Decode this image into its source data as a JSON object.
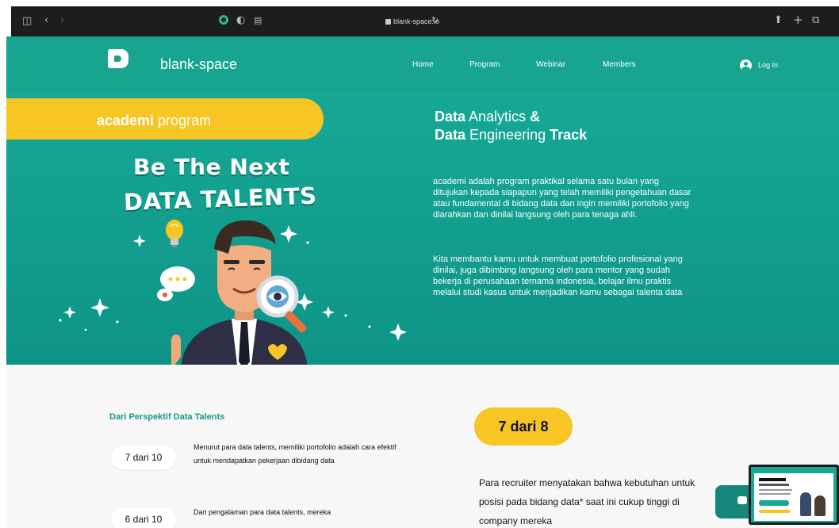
{
  "browser": {
    "url": "blank-space.io"
  },
  "nav": {
    "brand": "blank-space",
    "links": [
      "Home",
      "Program",
      "Webinar",
      "Members"
    ],
    "login": "Log In"
  },
  "hero": {
    "pill_bold": "academi",
    "pill_rest": " program",
    "art_line1": "Be The Next",
    "art_line2": "DATA TALENTS",
    "heading": {
      "l1_a": "Data",
      "l1_b": " Analytics ",
      "l1_c": "&",
      "l2_a": "Data",
      "l2_b": " Engineering ",
      "l2_c": "Track"
    },
    "paragraph1": "academi adalah program praktikal selama satu bulan yang ditujukan kepada siapapun yang telah memiliki pengetahuan dasar atau fundamental di bidang data dan ingin memiliki portofolio yang diarahkan dan dinilai langsung oleh para tenaga ahli.",
    "paragraph2": "Kita membantu kamu untuk membuat portofolio profesional yang dinilai, juga dibimbing langsung oleh para mentor yang sudah bekerja di  perusahaan ternama indonesia, belajar ilmu praktis melalui studi kasus untuk menjadikan kamu sebagai talenta data"
  },
  "perspective": {
    "title": "Dari Perspektif Data Talents",
    "stats": [
      {
        "badge": "7 dari 10",
        "text": "Menurut para data talents,  memiliki portofolio adalah cara efektif untuk mendapatkan pekerjaan dibidang data"
      },
      {
        "badge": "6 dari 10",
        "text": "Dari pengalaman para data talents, mereka"
      }
    ]
  },
  "recruiter": {
    "stat": "7 dari 8",
    "text": "Para recruiter menyatakan bahwa kebutuhan untuk posisi pada bidang data* saat ini cukup tinggi di company mereka"
  },
  "colors": {
    "teal": "#17a58f",
    "yellow": "#f7c624",
    "dark_teal": "#15867a"
  }
}
